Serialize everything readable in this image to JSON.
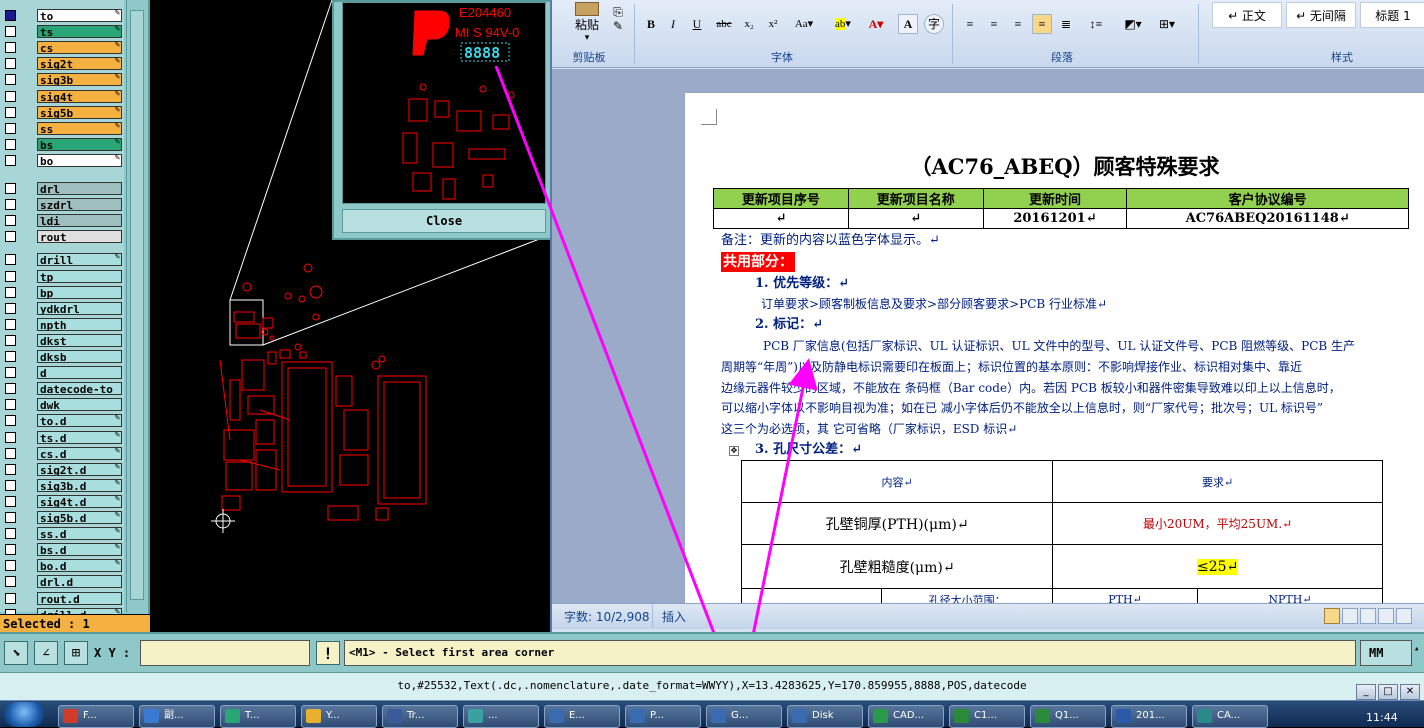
{
  "layers": {
    "items": [
      {
        "name": "to",
        "color": "white",
        "checked": true,
        "pen": true
      },
      {
        "name": "ts",
        "color": "green",
        "checked": false,
        "pen": true
      },
      {
        "name": "cs",
        "color": "orange",
        "checked": false,
        "pen": true
      },
      {
        "name": "sig2t",
        "color": "orange",
        "checked": false,
        "pen": true
      },
      {
        "name": "sig3b",
        "color": "orange",
        "checked": false,
        "pen": true
      },
      {
        "name": "sig4t",
        "color": "orange",
        "checked": false,
        "pen": true
      },
      {
        "name": "sig5b",
        "color": "orange",
        "checked": false,
        "pen": true
      },
      {
        "name": "ss",
        "color": "orange",
        "checked": false,
        "pen": true
      },
      {
        "name": "bs",
        "color": "green",
        "checked": false,
        "pen": true
      },
      {
        "name": "bo",
        "color": "white",
        "checked": false,
        "pen": true
      },
      {
        "name": "drl",
        "color": "grey",
        "checked": false,
        "pen": false
      },
      {
        "name": "szdrl",
        "color": "grey",
        "checked": false,
        "pen": false
      },
      {
        "name": "ldi",
        "color": "grey",
        "checked": false,
        "pen": false
      },
      {
        "name": "rout",
        "color": "lgrey",
        "checked": false,
        "pen": false
      },
      {
        "name": "drill",
        "color": "cyan",
        "checked": false,
        "pen": true
      },
      {
        "name": "tp",
        "color": "cyan",
        "checked": false,
        "pen": false
      },
      {
        "name": "bp",
        "color": "cyan",
        "checked": false,
        "pen": false
      },
      {
        "name": "ydkdrl",
        "color": "cyan",
        "checked": false,
        "pen": false
      },
      {
        "name": "npth",
        "color": "cyan",
        "checked": false,
        "pen": false
      },
      {
        "name": "dkst",
        "color": "cyan",
        "checked": false,
        "pen": false
      },
      {
        "name": "dksb",
        "color": "cyan",
        "checked": false,
        "pen": false
      },
      {
        "name": "d",
        "color": "cyan",
        "checked": false,
        "pen": false
      },
      {
        "name": "datecode-to",
        "color": "cyan",
        "checked": false,
        "pen": false
      },
      {
        "name": "dwk",
        "color": "cyan",
        "checked": false,
        "pen": false
      },
      {
        "name": "to.d",
        "color": "cyan",
        "checked": false,
        "pen": true
      },
      {
        "name": "ts.d",
        "color": "cyan",
        "checked": false,
        "pen": true
      },
      {
        "name": "cs.d",
        "color": "cyan",
        "checked": false,
        "pen": true
      },
      {
        "name": "sig2t.d",
        "color": "cyan",
        "checked": false,
        "pen": true
      },
      {
        "name": "sig3b.d",
        "color": "cyan",
        "checked": false,
        "pen": true
      },
      {
        "name": "sig4t.d",
        "color": "cyan",
        "checked": false,
        "pen": true
      },
      {
        "name": "sig5b.d",
        "color": "cyan",
        "checked": false,
        "pen": true
      },
      {
        "name": "ss.d",
        "color": "cyan",
        "checked": false,
        "pen": true
      },
      {
        "name": "bs.d",
        "color": "cyan",
        "checked": false,
        "pen": true
      },
      {
        "name": "bo.d",
        "color": "cyan",
        "checked": false,
        "pen": true
      },
      {
        "name": "drl.d",
        "color": "cyan",
        "checked": false,
        "pen": false
      },
      {
        "name": "rout.d",
        "color": "cyan",
        "checked": false,
        "pen": false
      },
      {
        "name": "drill.d",
        "color": "cyan",
        "checked": false,
        "pen": true
      }
    ],
    "selected_label": "Selected : 1"
  },
  "zoom": {
    "text1": "E204460",
    "text2": "MI S 94V-0",
    "text3": "8888",
    "close_label": "Close"
  },
  "word": {
    "ribbon": {
      "paste_label": "粘贴",
      "clipboard_group": "剪贴板",
      "font_group": "字体",
      "paragraph_group": "段落",
      "styles_group": "样式",
      "style1": "↵ 正文",
      "style2": "↵ 无间隔",
      "style3": "标题 1"
    },
    "doc": {
      "title": "（AC76_ABEQ）顾客特殊要求",
      "table1_headers": [
        "更新项目序号",
        "更新项目名称",
        "更新时间",
        "客户协议编号"
      ],
      "table1_row": [
        "↵",
        "↵",
        "20161201↵",
        "AC76ABEQ20161148↵"
      ],
      "note": "备注：更新的内容以蓝色字体显示。↵",
      "common_heading": "共用部分：",
      "s1_heading": "1. 优先等级：↵",
      "s1_text": "订单要求>顾客制板信息及要求>部分顾客要求>PCB 行业标准↵",
      "s2_heading": "2. 标记：↵",
      "s2_line1": "PCB 厂家信息(包括厂家标识、UL 认证标识、UL 文件中的型号、UL 认证文件号、PCB 阻燃等级、PCB 生产",
      "s2_line2": "周期等“年周”)以及防静电标识需要印在板面上；标识位置的基本原则：不影响焊接作业、标识相对集中、靠近",
      "s2_line3": "边缘元器件较少的区域，不能放在 条码框（Bar code）内。若因 PCB 板较小和器件密集导致难以印上以上信息时，",
      "s2_line4": "可以缩小字体以不影响目视为准；如在已 减小字体后仍不能放全以上信息时，则“厂家代号；批次号；UL 标识号”",
      "s2_line5": "这三个为必选项，其 它可省略（厂家标识，ESD 标识↵",
      "s3_heading": "3. 孔尺寸公差：↵",
      "table2_h1": "内容↵",
      "table2_h2": "要求↵",
      "table2_r1_label": "孔壁铜厚(PTH)(μm)↵",
      "table2_r1_value": "最小20UM，平均25UM.↵",
      "table2_r2_label": "孔壁粗糙度(μm)↵",
      "table2_r2_value": "≤25↵",
      "table2_r3_a": "孔径大小范围：",
      "table2_r3_b": "PTH↵",
      "table2_r3_c": "NPTH↵"
    },
    "status": {
      "word_count": "字数: 10/2,908",
      "insert_mode": "插入"
    }
  },
  "cmd": {
    "xy_label": "X Y :",
    "xy_value": "",
    "prompt": "<M1> - Select first area corner",
    "units": "MM",
    "output": "to,#25532,Text(.dc,.nomenclature,.date_format=WWYY),X=13.4283625,Y=170.859955,8888,POS,datecode"
  },
  "taskbar": {
    "items": [
      {
        "label": "F...",
        "color": "#d23a2a"
      },
      {
        "label": "副...",
        "color": "#3a7ad2"
      },
      {
        "label": "T...",
        "color": "#2aa576"
      },
      {
        "label": "Y...",
        "color": "#e8b030"
      },
      {
        "label": "Tr...",
        "color": "#3a5a9a"
      },
      {
        "label": "...",
        "color": "#3aa0a0"
      },
      {
        "label": "E...",
        "color": "#3a6ab0"
      },
      {
        "label": "P...",
        "color": "#3a6ab0"
      },
      {
        "label": "G...",
        "color": "#3a6ab0"
      },
      {
        "label": "Disk",
        "color": "#3a6ab0"
      },
      {
        "label": "CAD...",
        "color": "#2a9a4a"
      },
      {
        "label": "C1...",
        "color": "#2a8a3a"
      },
      {
        "label": "Q1...",
        "color": "#2a8a3a"
      },
      {
        "label": "201...",
        "color": "#2a5aa8"
      },
      {
        "label": "CA...",
        "color": "#2a8a8a"
      }
    ],
    "clock": "11:44"
  },
  "colors": {
    "annotation": "#ff00ff",
    "pcb_red": "#ff0000",
    "zoom_cyan": "#3ad8e8"
  }
}
